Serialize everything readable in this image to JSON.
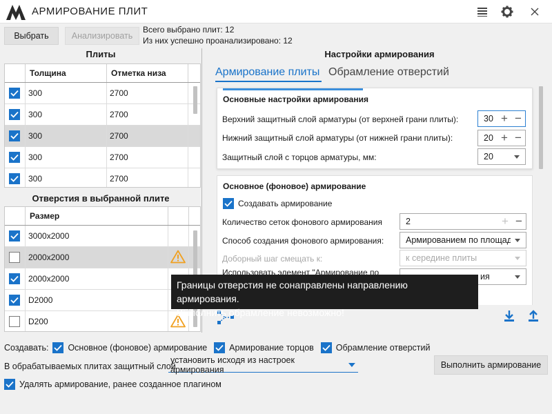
{
  "app": {
    "title": "АРМИРОВАНИЕ ПЛИТ"
  },
  "toolbar": {
    "select_label": "Выбрать",
    "analyze_label": "Анализировать",
    "total_selected": "Всего выбрано плит: 12",
    "analyzed": "Из них успешно проанализировано: 12"
  },
  "slabs": {
    "title": "Плиты",
    "columns": [
      "Толщина",
      "Отметка низа"
    ],
    "rows": [
      {
        "checked": true,
        "thickness": "300",
        "level": "2700"
      },
      {
        "checked": true,
        "thickness": "300",
        "level": "2700"
      },
      {
        "checked": true,
        "thickness": "300",
        "level": "2700",
        "selected": true
      },
      {
        "checked": true,
        "thickness": "300",
        "level": "2700"
      },
      {
        "checked": true,
        "thickness": "300",
        "level": "2700"
      }
    ]
  },
  "openings": {
    "title": "Отверстия в выбранной плите",
    "columns": [
      "Размер"
    ],
    "rows": [
      {
        "checked": true,
        "size": "3000x2000",
        "warning": false
      },
      {
        "checked": false,
        "size": "2000x2000",
        "warning": true,
        "selected": true
      },
      {
        "checked": true,
        "size": "2000x2000",
        "warning": false
      },
      {
        "checked": true,
        "size": "D2000",
        "warning": false
      },
      {
        "checked": false,
        "size": "D200",
        "warning": true
      }
    ]
  },
  "settings": {
    "title": "Настройки армирования",
    "tabs": [
      {
        "label": "Армирование плиты",
        "active": true
      },
      {
        "label": "Обрамление отверстий",
        "active": false
      }
    ],
    "basic": {
      "title": "Основные настройки армирования",
      "top_cover_label": "Верхний защитный слой арматуры (от верхней грани плиты):",
      "top_cover_value": "30",
      "bottom_cover_label": "Нижний защитный слой арматуры (от нижней грани плиты):",
      "bottom_cover_value": "20",
      "end_cover_label": "Защитный слой с торцов арматуры, мм:",
      "end_cover_value": "20"
    },
    "background": {
      "title": "Основное (фоновое) армирование",
      "create_label": "Создавать армирование",
      "mesh_count_label": "Количество сеток фонового армирования",
      "mesh_count_value": "2",
      "method_label": "Способ создания фонового армирования:",
      "method_value": "Армированием по площади",
      "step_label": "Доборный шаг смещать к:",
      "step_value": "к середине плиты",
      "use_element_label": "Использовать элемент \"Армирование по",
      "use_element_value": "ия"
    }
  },
  "tooltip": {
    "line1": "Границы отверстия не сонаправлены направлению армирования.",
    "line2": "Выполнить обрамление невозможно!"
  },
  "bottom": {
    "create_label": "Создавать:",
    "opt_background": "Основное (фоновое) армирование",
    "opt_ends": "Армирование торцов",
    "opt_openings": "Обрамление отверстий",
    "cover_label": "В обрабатываемых плитах защитный слой",
    "cover_value": "установить исходя из настроек армирования",
    "run_label": "Выполнить армирование",
    "delete_label": "Удалять армирование, ранее созданное плагином"
  },
  "colors": {
    "accent": "#1a73c9",
    "warning": "#f0a020"
  }
}
